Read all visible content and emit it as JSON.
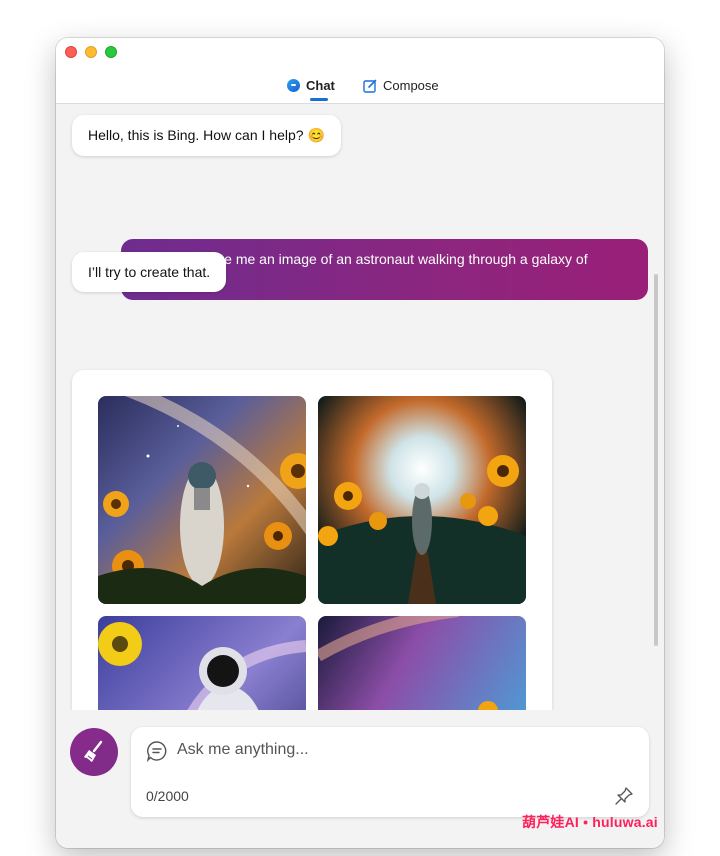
{
  "tabs": [
    {
      "label": "Chat",
      "icon": "bing-chat-icon",
      "active": true
    },
    {
      "label": "Compose",
      "icon": "compose-icon",
      "active": false
    }
  ],
  "messages": {
    "greeting": "Hello, this is Bing. How can I help? 😊",
    "user_prompt": "Can you create me an image of an astronaut walking through a galaxy of sunflowers?",
    "reply": "I’ll try to create that."
  },
  "images": [
    {
      "subject": "astronaut in sunflower field under galaxy"
    },
    {
      "subject": "astronaut walking path toward bright light"
    },
    {
      "subject": "astronaut close-up with sunflowers and planet ring"
    },
    {
      "subject": "astronaut standing in sunflower meadow"
    }
  ],
  "input": {
    "placeholder": "Ask me anything...",
    "char_count": "0/2000"
  },
  "watermark": "葫芦娃AI  •  huluwa.ai",
  "colors": {
    "user_bubble": "#8c267f",
    "accent_blue": "#1b6ed6",
    "broom_button": "#82298b"
  }
}
